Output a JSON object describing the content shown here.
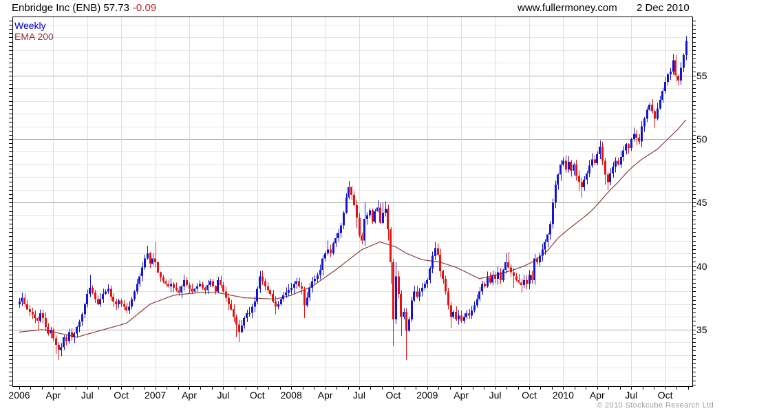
{
  "header": {
    "title_main": "Enbridge Inc (ENB) 57.73",
    "title_change": "-0.09",
    "website": "www.fullermoney.com",
    "date": "2 Dec 2010"
  },
  "legend": {
    "timeframe": "Weekly",
    "overlay": "EMA 200"
  },
  "footer": {
    "copyright": "© 2010 Stockcube Research Ltd"
  },
  "colors": {
    "up_candle": "#1515d0",
    "down_candle": "#e51212",
    "ema_line": "#8b3d3d",
    "grid_minor": "#e6e6e6",
    "grid_major": "#ababab",
    "grid_vertical": "#dedede",
    "axis": "#000000",
    "change_text": "#bb2222",
    "legend_weekly": "#0000bb",
    "legend_ema": "#993333",
    "copyright_text": "#9b9b9b"
  },
  "chart_data": {
    "type": "candlestick",
    "title": "Enbridge Inc (ENB) weekly candlestick chart with EMA 200 overlay",
    "instrument": "Enbridge Inc",
    "ticker": "ENB",
    "last_price": 57.73,
    "change": -0.09,
    "timeframe": "Weekly",
    "overlay": "EMA 200",
    "ylim": [
      30.6,
      59.6
    ],
    "y_ticks": [
      55,
      50,
      45,
      40,
      35
    ],
    "x_labels": [
      "2006",
      "Apr",
      "Jul",
      "Oct",
      "2007",
      "Apr",
      "Jul",
      "Oct",
      "2008",
      "Apr",
      "Jul",
      "Oct",
      "2009",
      "Apr",
      "Jul",
      "Oct",
      "2010",
      "Apr",
      "Jul",
      "Oct"
    ],
    "weeks_per_year": 52,
    "closes": [
      37.2,
      37.5,
      37.0,
      36.6,
      36.4,
      36.2,
      35.9,
      35.7,
      36.3,
      35.9,
      35.2,
      34.7,
      35.0,
      34.3,
      33.8,
      33.4,
      33.6,
      34.4,
      34.1,
      34.8,
      34.4,
      34.7,
      35.2,
      35.6,
      36.2,
      37.0,
      37.8,
      38.3,
      37.9,
      37.4,
      37.0,
      37.4,
      37.8,
      38.0,
      38.2,
      37.6,
      37.2,
      37.0,
      37.3,
      37.0,
      36.8,
      36.5,
      36.8,
      37.4,
      38.0,
      38.6,
      39.2,
      39.9,
      40.6,
      41.0,
      40.2,
      40.6,
      40.3,
      39.5,
      39.1,
      38.8,
      38.6,
      38.4,
      38.6,
      38.3,
      38.1,
      37.9,
      38.4,
      38.9,
      38.5,
      38.2,
      38.0,
      38.2,
      38.4,
      38.6,
      38.3,
      38.1,
      38.5,
      38.8,
      38.4,
      38.0,
      38.9,
      38.5,
      38.0,
      37.5,
      37.0,
      36.6,
      36.0,
      35.4,
      34.8,
      35.3,
      35.9,
      36.3,
      36.3,
      36.8,
      37.2,
      38.2,
      39.2,
      38.8,
      38.4,
      38.1,
      37.8,
      37.2,
      36.8,
      37.0,
      37.4,
      37.7,
      37.9,
      38.1,
      38.3,
      38.6,
      38.8,
      38.4,
      38.2,
      36.9,
      37.5,
      38.3,
      38.8,
      39.0,
      39.3,
      39.7,
      40.6,
      41.0,
      41.3,
      41.0,
      41.8,
      42.2,
      42.6,
      43.2,
      44.2,
      45.4,
      46.2,
      45.6,
      44.8,
      43.8,
      42.4,
      42.0,
      43.7,
      44.0,
      44.4,
      43.5,
      44.3,
      44.6,
      43.4,
      44.2,
      44.5,
      42.9,
      40.3,
      35.8,
      39.2,
      37.8,
      36.0,
      36.4,
      34.9,
      35.8,
      37.3,
      38.0,
      37.6,
      38.0,
      38.3,
      38.6,
      38.9,
      39.8,
      40.8,
      41.4,
      40.9,
      39.6,
      39.0,
      38.0,
      36.9,
      36.0,
      36.4,
      35.8,
      36.1,
      35.7,
      36.0,
      36.3,
      36.1,
      36.5,
      36.9,
      37.4,
      38.0,
      38.6,
      38.4,
      39.1,
      38.7,
      39.3,
      39.0,
      39.5,
      38.9,
      39.7,
      40.3,
      39.9,
      39.5,
      39.2,
      38.9,
      38.7,
      38.5,
      38.9,
      38.6,
      39.3,
      38.9,
      40.6,
      40.3,
      40.8,
      41.3,
      41.9,
      42.5,
      43.3,
      45.0,
      46.4,
      47.2,
      48.0,
      48.3,
      47.6,
      48.2,
      47.5,
      48.0,
      47.1,
      46.6,
      46.2,
      46.8,
      47.3,
      47.9,
      48.4,
      48.1,
      48.8,
      49.4,
      48.3,
      47.2,
      46.6,
      47.3,
      47.8,
      48.3,
      48.0,
      48.6,
      49.1,
      49.6,
      49.3,
      50.0,
      50.4,
      50.1,
      49.8,
      51.0,
      51.6,
      52.3,
      52.7,
      52.2,
      51.6,
      52.4,
      53.1,
      53.8,
      54.5,
      55.1,
      55.3,
      56.2,
      55.0,
      54.6,
      55.6,
      56.6,
      57.73
    ],
    "first_open": 37.0,
    "wick_overrides": {
      "1": {
        "h": 37.9
      },
      "7": {
        "l": 34.9
      },
      "14": {
        "l": 33.1
      },
      "15": {
        "l": 32.6
      },
      "16": {
        "l": 32.9
      },
      "27": {
        "h": 39.3
      },
      "49": {
        "h": 41.6
      },
      "52": {
        "h": 41.9
      },
      "83": {
        "l": 34.4
      },
      "84": {
        "l": 34.0
      },
      "92": {
        "h": 39.6
      },
      "98": {
        "l": 36.2
      },
      "109": {
        "l": 35.9
      },
      "118": {
        "h": 42.0
      },
      "126": {
        "h": 46.7
      },
      "129": {
        "l": 43.0
      },
      "132": {
        "h": 45.0
      },
      "137": {
        "h": 45.2
      },
      "139": {
        "h": 45.0
      },
      "140": {
        "h": 45.1
      },
      "141": {
        "l": 42.0
      },
      "142": {
        "l": 38.6
      },
      "143": {
        "l": 33.7
      },
      "144": {
        "h": 40.3
      },
      "146": {
        "l": 34.5
      },
      "148": {
        "l": 32.6
      },
      "159": {
        "h": 41.9
      },
      "165": {
        "l": 35.1
      },
      "186": {
        "h": 41.0
      },
      "187": {
        "h": 41.1
      },
      "189": {
        "l": 38.3
      },
      "192": {
        "l": 37.9
      },
      "214": {
        "l": 45.9
      },
      "215": {
        "l": 45.4
      },
      "219": {
        "h": 48.9
      },
      "222": {
        "h": 49.9
      },
      "224": {
        "l": 46.4
      },
      "225": {
        "l": 46.0
      },
      "235": {
        "h": 50.9
      },
      "236": {
        "l": 49.5
      },
      "243": {
        "l": 50.9
      },
      "250": {
        "h": 56.7
      },
      "252": {
        "l": 54.2
      },
      "255": {
        "h": 58.1
      }
    },
    "ema_anchors": [
      [
        0,
        34.8
      ],
      [
        9,
        35.0
      ],
      [
        22,
        34.4
      ],
      [
        41,
        35.5
      ],
      [
        50,
        37.0
      ],
      [
        59,
        37.7
      ],
      [
        68,
        37.9
      ],
      [
        76,
        37.9
      ],
      [
        86,
        37.5
      ],
      [
        98,
        37.4
      ],
      [
        104,
        37.7
      ],
      [
        112,
        38.4
      ],
      [
        121,
        39.7
      ],
      [
        131,
        41.3
      ],
      [
        138,
        41.9
      ],
      [
        144,
        41.5
      ],
      [
        148,
        41.0
      ],
      [
        154,
        40.5
      ],
      [
        161,
        40.3
      ],
      [
        167,
        39.9
      ],
      [
        172,
        39.4
      ],
      [
        176,
        39.0
      ],
      [
        184,
        39.4
      ],
      [
        189,
        39.7
      ],
      [
        193,
        40.0
      ],
      [
        197,
        40.4
      ],
      [
        202,
        41.2
      ],
      [
        206,
        42.2
      ],
      [
        210,
        42.9
      ],
      [
        215,
        43.7
      ],
      [
        218,
        44.2
      ],
      [
        220,
        44.6
      ],
      [
        223,
        45.3
      ],
      [
        226,
        46.0
      ],
      [
        229,
        46.6
      ],
      [
        232,
        47.3
      ],
      [
        235,
        47.9
      ],
      [
        238,
        48.4
      ],
      [
        241,
        48.8
      ],
      [
        244,
        49.2
      ],
      [
        247,
        49.8
      ],
      [
        250,
        50.4
      ],
      [
        252,
        50.8
      ],
      [
        254,
        51.3
      ],
      [
        255,
        51.5
      ]
    ]
  }
}
